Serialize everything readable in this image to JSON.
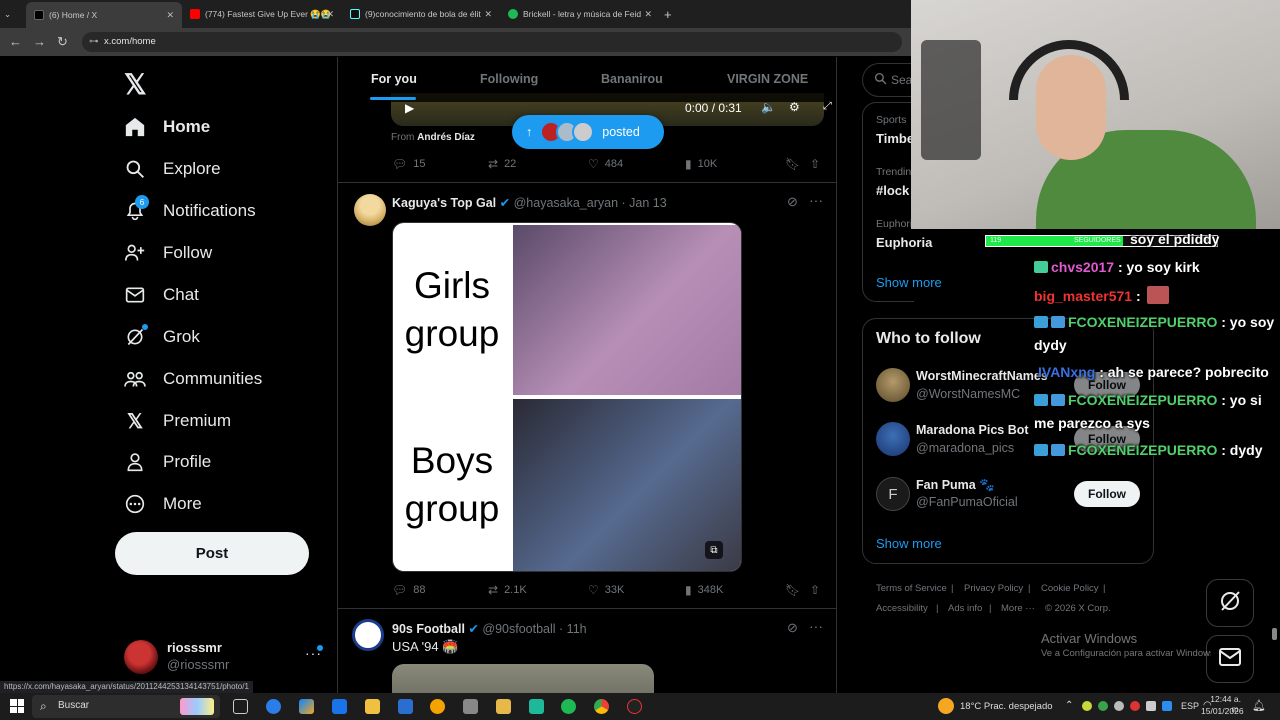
{
  "browser": {
    "tabs": [
      {
        "label": "(6) Home / X"
      },
      {
        "label": "(774) Fastest Give Up Ever 😭😭"
      },
      {
        "label": "(9)conocimiento de bola de élit"
      },
      {
        "label": "Brickell - letra y música de Feid"
      }
    ],
    "url": "x.com/home",
    "status_url": "https://x.com/hayasaka_aryan/status/2011244253134143751/photo/1"
  },
  "nav": {
    "items": [
      {
        "label": "Home",
        "icon": "home-icon"
      },
      {
        "label": "Explore",
        "icon": "search-icon"
      },
      {
        "label": "Notifications",
        "icon": "bell-icon",
        "badge": "6"
      },
      {
        "label": "Follow",
        "icon": "add-person-icon"
      },
      {
        "label": "Chat",
        "icon": "mail-icon"
      },
      {
        "label": "Grok",
        "icon": "grok-icon"
      },
      {
        "label": "Communities",
        "icon": "people-icon"
      },
      {
        "label": "Premium",
        "icon": "x-logo-icon"
      },
      {
        "label": "Profile",
        "icon": "person-icon"
      },
      {
        "label": "More",
        "icon": "more-circle-icon"
      }
    ],
    "post_label": "Post",
    "account": {
      "name": "riosssmr",
      "handle": "@riosssmr"
    }
  },
  "timeline": {
    "tabs": [
      "For you",
      "Following",
      "Bananirou",
      "VIRGIN ZONE"
    ],
    "video": {
      "time": "0:00 / 0:31",
      "from_label": "From",
      "from_name": "Andrés Díaz"
    },
    "posted_label": "posted",
    "post1_stats": {
      "replies": "15",
      "reposts": "22",
      "likes": "484",
      "views": "10K"
    },
    "post2": {
      "author": "Kaguya's Top Gal",
      "handle": "@hayasaka_aryan",
      "time": "· Jan 13",
      "meme_top": "Girls group",
      "meme_bottom": "Boys group",
      "stats": {
        "replies": "88",
        "reposts": "2.1K",
        "likes": "33K",
        "views": "348K"
      }
    },
    "post3": {
      "author": "90s Football",
      "handle": "@90sfootball",
      "time": "· 11h",
      "text": "USA '94 🏟️"
    }
  },
  "sidebar": {
    "search_placeholder": "Sea",
    "trends": [
      {
        "category": "Sports",
        "name": "Timbe"
      },
      {
        "category": "Trendin",
        "name": "#lock"
      },
      {
        "category": "Euphoria · Trending",
        "name": "Euphoria"
      }
    ],
    "show_more": "Show more",
    "who_to_follow_title": "Who to follow",
    "suggestions": [
      {
        "name": "WorstMinecraftNames",
        "handle": "@WorstNamesMC",
        "button": "Follow"
      },
      {
        "name": "Maradona Pics Bot",
        "handle": "@maradona_pics",
        "button": "Follow"
      },
      {
        "name": "Fan Puma 🐾",
        "handle": "@FanPumaOficial",
        "button": "Follow"
      }
    ],
    "show_more_2": "Show more",
    "footer": [
      "Terms of Service",
      "|",
      "Privacy Policy",
      "|",
      "Cookie Policy",
      "|",
      "Accessibility",
      "|",
      "Ads info",
      "|",
      "More ···",
      "© 2026 X Corp."
    ]
  },
  "overlay": {
    "followers_bar": {
      "left": "119",
      "label": "SEGUIDORES",
      "right": "200"
    },
    "chat": [
      {
        "user": "",
        "msg": "soy el pdiddy"
      },
      {
        "user": "chvs2017",
        "msg": ": yo soy kirk"
      },
      {
        "user": "big_master571",
        "msg": ":"
      },
      {
        "user": "FCOXENEIZEPUERRO",
        "msg": ": yo soy"
      },
      {
        "user": "",
        "msg": "dydy"
      },
      {
        "user": "IVANxng",
        "msg": ": ah se parece? pobrecito"
      },
      {
        "user": "FCOXENEIZEPUERRO",
        "msg": ": yo si"
      },
      {
        "user": "",
        "msg": "me parezco a sys"
      },
      {
        "user": "FCOXENEIZEPUERRO",
        "msg": ": dydy"
      }
    ],
    "activate_title": "Activar Windows",
    "activate_sub": "Ve a Configuración para activar Windows."
  },
  "taskbar": {
    "search": "Buscar",
    "weather": "18°C  Prac. despejado",
    "lang": "ESP",
    "time": "12:44 a. m.",
    "date": "15/01/2026"
  },
  "colors": {
    "accent": "#1d9bf0",
    "bg": "#000000",
    "border": "#2f3336",
    "muted": "#71767b"
  }
}
